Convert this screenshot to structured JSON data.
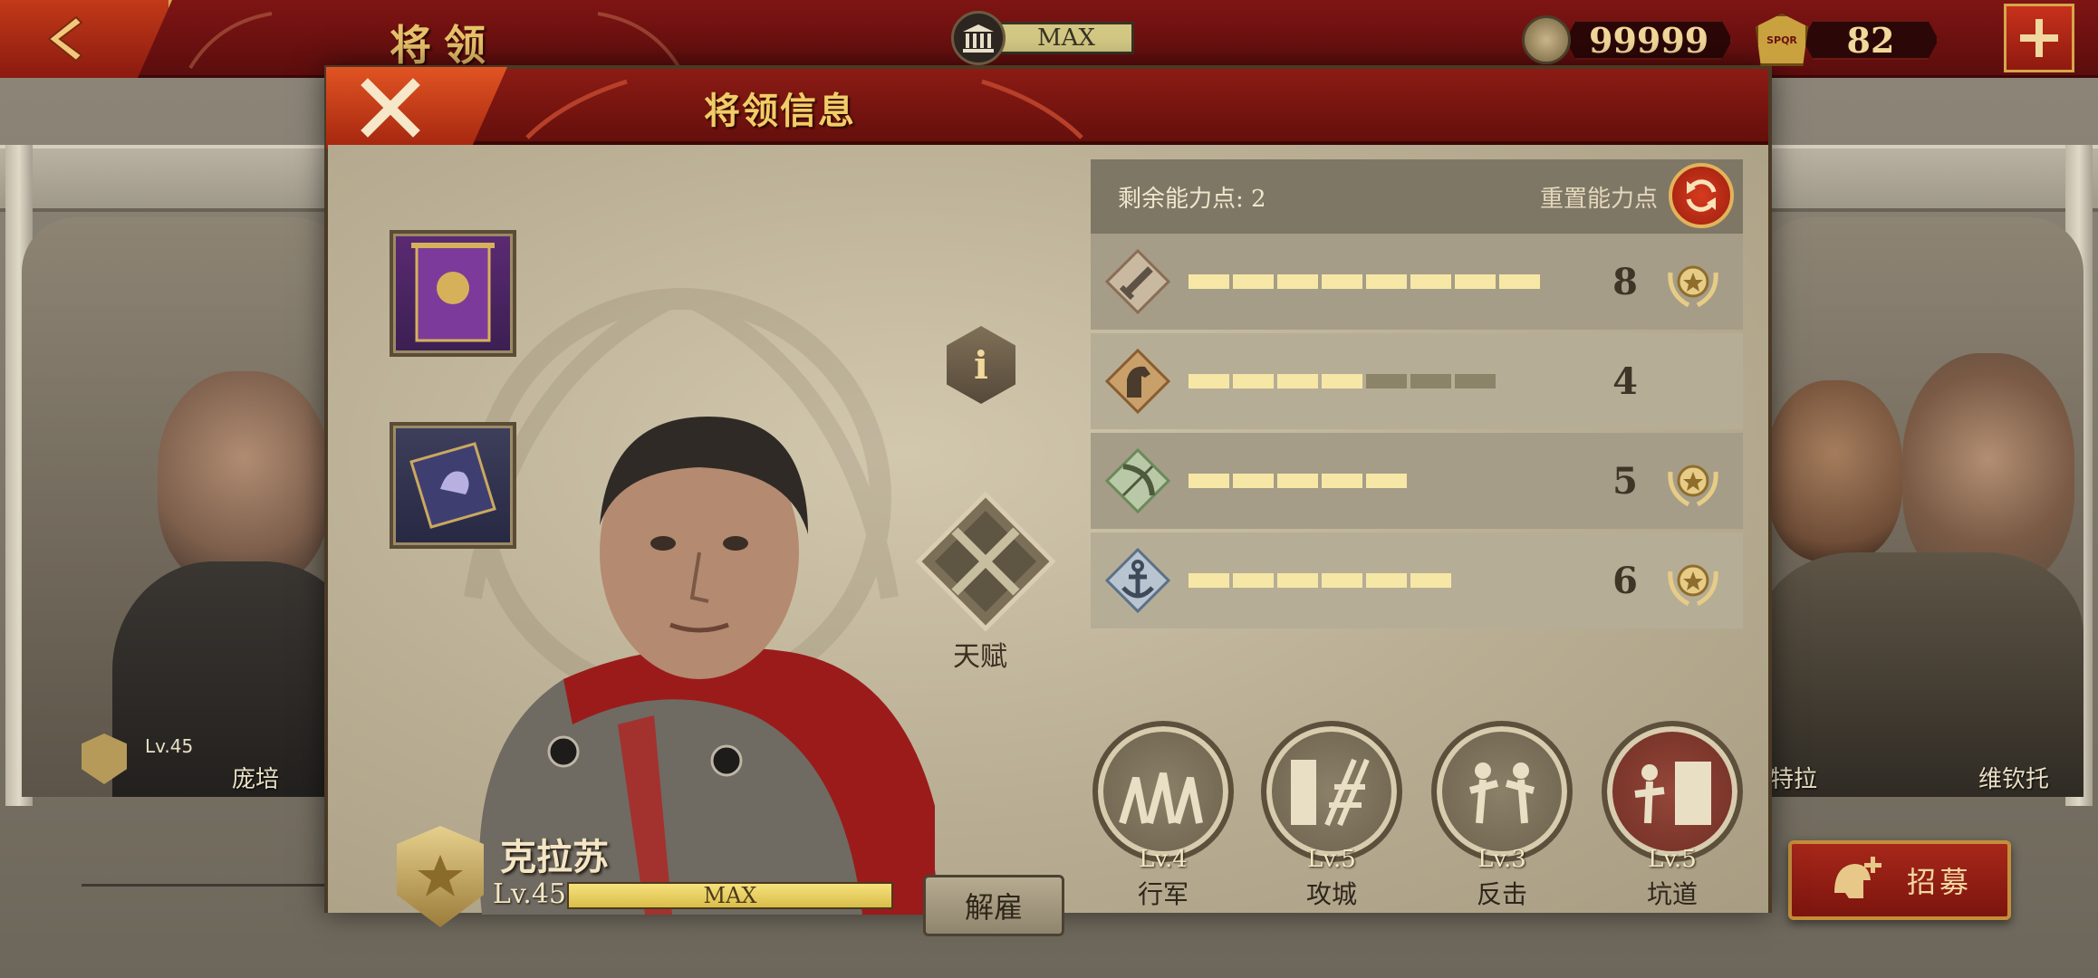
{
  "topbar": {
    "title": "将领",
    "building_level": "MAX",
    "coins": "99999",
    "spqr_tokens": "82",
    "spqr_badge_text": "SPQR"
  },
  "side_heroes": {
    "left": {
      "name": "庞培",
      "level": "Lv.45"
    },
    "right_1": {
      "name": "特拉"
    },
    "right_2": {
      "name": "维钦托"
    }
  },
  "recruit_button": "招募",
  "modal": {
    "title": "将领信息",
    "info_label": "i",
    "talent_label": "天赋",
    "hero": {
      "name": "克拉苏",
      "level": "Lv.45",
      "exp_bar": "MAX"
    },
    "dismiss_button": "解雇",
    "ability": {
      "remaining_points_label": "剩余能力点: 2",
      "reset_label": "重置能力点",
      "stats": [
        {
          "icon": "sword-icon",
          "value": "8",
          "filled": 8,
          "total": 8,
          "maxed": true
        },
        {
          "icon": "horse-icon",
          "value": "4",
          "filled": 4,
          "total": 7,
          "maxed": false
        },
        {
          "icon": "bow-icon",
          "value": "5",
          "filled": 5,
          "total": 5,
          "maxed": true
        },
        {
          "icon": "anchor-icon",
          "value": "6",
          "filled": 6,
          "total": 6,
          "maxed": true
        }
      ]
    },
    "skills": [
      {
        "name": "行军",
        "level": "Lv.4"
      },
      {
        "name": "攻城",
        "level": "Lv.5"
      },
      {
        "name": "反击",
        "level": "Lv.3"
      },
      {
        "name": "坑道",
        "level": "Lv.5"
      }
    ]
  }
}
